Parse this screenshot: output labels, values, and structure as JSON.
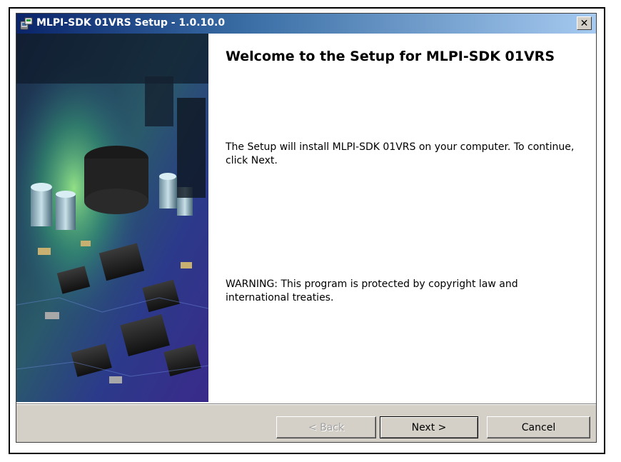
{
  "window": {
    "title": "MLPI-SDK 01VRS Setup - 1.0.10.0",
    "close_label": "✕"
  },
  "content": {
    "heading": "Welcome to the Setup for MLPI-SDK 01VRS",
    "intro": "The Setup will install MLPI-SDK 01VRS on your computer. To continue, click Next.",
    "warning": "WARNING: This program is protected by copyright law and international treaties."
  },
  "buttons": {
    "back": "< Back",
    "next": "Next >",
    "cancel": "Cancel"
  },
  "colors": {
    "titlebar_start": "#0a246a",
    "titlebar_end": "#a6caf0",
    "dialog_face": "#d4d0c8"
  },
  "icons": {
    "title": "installer-icon",
    "side_image": "circuit-board-image"
  }
}
